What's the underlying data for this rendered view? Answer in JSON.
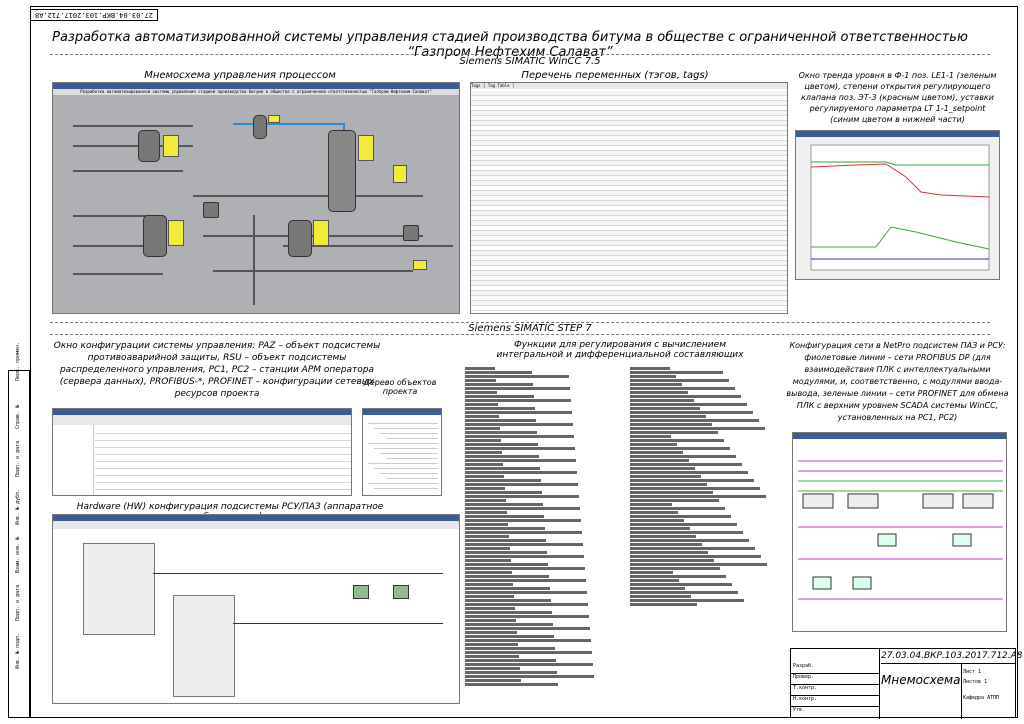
{
  "corner_code": "27.03.04.ВКР.103.2017.712.А8",
  "main_title": "Разработка автоматизированной системы управления стадией производства битума в обществе с ограниченной ответственностью “Газпром Нефтехим Салават”",
  "section_wincc": "Siemens SIMATIC WinCC 7.5",
  "section_step7": "Siemens SIMATIC STEP 7",
  "captions": {
    "mnemo": "Мнемосхема управления процессом",
    "tags": "Перечень переменных (тэгов, tags)",
    "trend": "Окно тренда уровня в Ф-1 поз. LE1-1 (зеленым цветом), степени открытия регулирующего клапана поз. ЭТ-3 (красным цветом), уставки регулируемого параметра LT 1-1_setpoint (синим цветом в нижней части)",
    "config": "Окно конфигурации системы управления: PAZ – объект подсистемы противоаварийной защиты, RSU – объект подсистемы распределенного управления, PC1, PC2 – станции АРМ оператора (сервера данных), PROFIBUS-*, PROFINET – конфигурации сетевых ресурсов проекта",
    "tree": "Дерево объектов проекта",
    "functions": "Функции для регулирования с вычислением интегральной и дифференциальной составляющих",
    "network": "Конфигурация сети в NetPro подсистем ПАЗ и РСУ: фиолетовые линии – сети PROFIBUS DP (для взаимодействия ПЛК с интеллектуальными модулями, и, соответственно, с модулями ввода-вывода, зеленые линии – сети PROFINET для обмена ПЛК с верхним уровнем SCADA системы WinCC, установленных на PC1, PC2)",
    "hw": "Hardware (HW) конфигурация подсистемы РСУ/ПАЗ (аппаратное обеспечение)"
  },
  "scada_title": "Разработка автоматизированной системы управления стадией производства битума в обществе с ограниченной ответственностью \"Газпром Нефтехим Салават\"",
  "tags_header": "Tags [ Tag Table ]",
  "stamp": {
    "code": "27.03.04.ВКР.103.2017.712.А8",
    "name": "Мнемосхема",
    "sheet": "Лист 1",
    "sheets": "Листов 1",
    "org": "Кафедра АТПП",
    "rows": [
      "Разраб.",
      "Провер.",
      "Т.контр.",
      "Н.контр.",
      "Утв."
    ]
  },
  "side_labels": [
    "Перв. примен.",
    "Справ. №",
    "Подп. и дата",
    "Инв. № дубл.",
    "Взам. инв. №",
    "Подп. и дата",
    "Инв. № подл."
  ],
  "colors": {
    "profibus": "#c23fc2",
    "profinet": "#3bb34a",
    "scada_bg": "#aeb0b4",
    "tag_yellow": "#f3ea3a"
  }
}
